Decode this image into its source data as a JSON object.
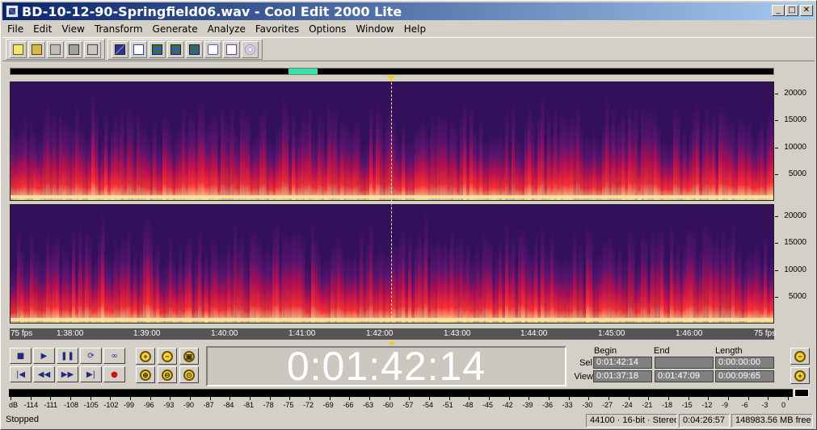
{
  "window": {
    "title": "BD-10-12-90-Springfield06.wav - Cool Edit 2000 Lite",
    "controls": [
      "_",
      "□",
      "✕"
    ]
  },
  "menu": [
    "File",
    "Edit",
    "View",
    "Transform",
    "Generate",
    "Analyze",
    "Favorites",
    "Options",
    "Window",
    "Help"
  ],
  "toolbar": {
    "file_icons": [
      "new-file-icon",
      "open-file-icon",
      "save-icon",
      "save-as-icon",
      "save-all-icon"
    ],
    "view_icons": [
      "waveform-view-icon",
      "spectral-view-icon",
      "multitrack-icon",
      "cue-list-icon",
      "play-list-icon",
      "info-icon",
      "properties-icon",
      "cd-icon"
    ]
  },
  "spectrogram": {
    "freq_ticks": [
      "20000",
      "15000",
      "10000",
      "5000"
    ],
    "colors": {
      "low": "#32105a",
      "mid": "#c01050",
      "high": "#ff3030",
      "peak": "#ffe6a0"
    }
  },
  "timeline": {
    "labels": [
      "75 fps",
      "1:38:00",
      "1:39:00",
      "1:40:00",
      "1:41:00",
      "1:42:00",
      "1:43:00",
      "1:44:00",
      "1:45:00",
      "1:46:00",
      "75 fps"
    ]
  },
  "transport": {
    "buttons": [
      "■",
      "▶",
      "❚❚",
      "⟳",
      "∞",
      "|◀",
      "◀◀",
      "▶▶",
      "▶|",
      "●"
    ]
  },
  "zoom": {
    "buttons": [
      "+",
      "−",
      "▣",
      "⊕",
      "⊖",
      "⊙"
    ]
  },
  "time_display": "0:01:42:14",
  "selection": {
    "headers": [
      "Begin",
      "End",
      "Length"
    ],
    "sel": {
      "label": "Sel",
      "begin": "0:01:42:14",
      "end": "",
      "length": "0:00:00:00"
    },
    "view": {
      "label": "View",
      "begin": "0:01:37:18",
      "end": "0:01:47:09",
      "length": "0:00:09:65"
    }
  },
  "meter": {
    "labels": [
      "dB",
      "-114",
      "-111",
      "-108",
      "-105",
      "-102",
      "-99",
      "-96",
      "-93",
      "-90",
      "-87",
      "-84",
      "-81",
      "-78",
      "-75",
      "-72",
      "-69",
      "-66",
      "-63",
      "-60",
      "-57",
      "-54",
      "-51",
      "-48",
      "-45",
      "-42",
      "-39",
      "-36",
      "-33",
      "-30",
      "-27",
      "-24",
      "-21",
      "-18",
      "-15",
      "-12",
      "-9",
      "-6",
      "-3",
      "0"
    ]
  },
  "status": {
    "state": "Stopped",
    "format": "44100 · 16-bit · Stereo",
    "duration": "0:04:26:57",
    "free": "148983.56 MB free"
  }
}
